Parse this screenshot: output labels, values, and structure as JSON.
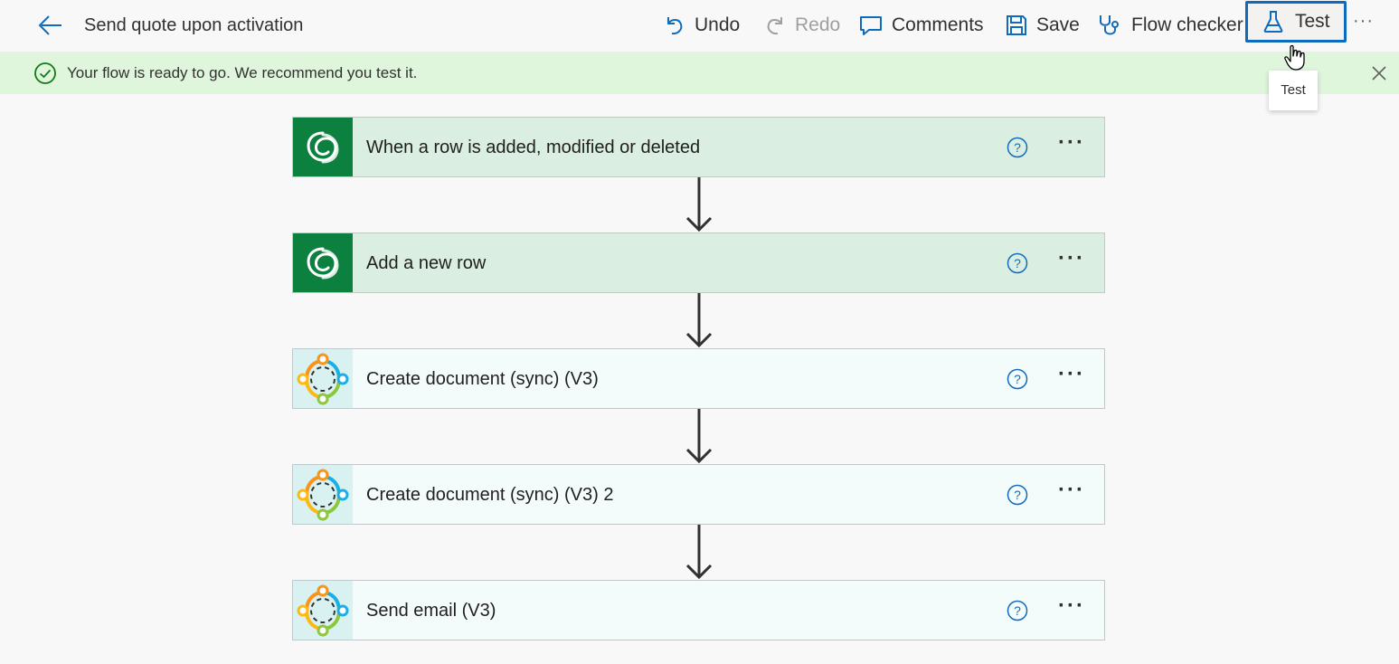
{
  "header": {
    "title": "Send quote upon activation",
    "commands": {
      "undo": "Undo",
      "redo": "Redo",
      "comments": "Comments",
      "save": "Save",
      "flow_checker": "Flow checker",
      "test": "Test",
      "more": "···"
    }
  },
  "banner": {
    "text": "Your flow is ready to go. We recommend you test it."
  },
  "tooltip": {
    "text": "Test"
  },
  "steps": [
    {
      "title": "When a row is added, modified or deleted",
      "icon": "dataverse-icon"
    },
    {
      "title": "Add a new row",
      "icon": "dataverse-icon"
    },
    {
      "title": "Create document (sync) (V3)",
      "icon": "connector-icon"
    },
    {
      "title": "Create document (sync) (V3) 2",
      "icon": "connector-icon"
    },
    {
      "title": "Send email (V3)",
      "icon": "connector-icon"
    }
  ],
  "colors": {
    "accent": "#0f6cbd",
    "banner_bg": "#dff6dd",
    "dataverse_green": "#0b803f",
    "trigger_card_bg": "#daeee2"
  }
}
